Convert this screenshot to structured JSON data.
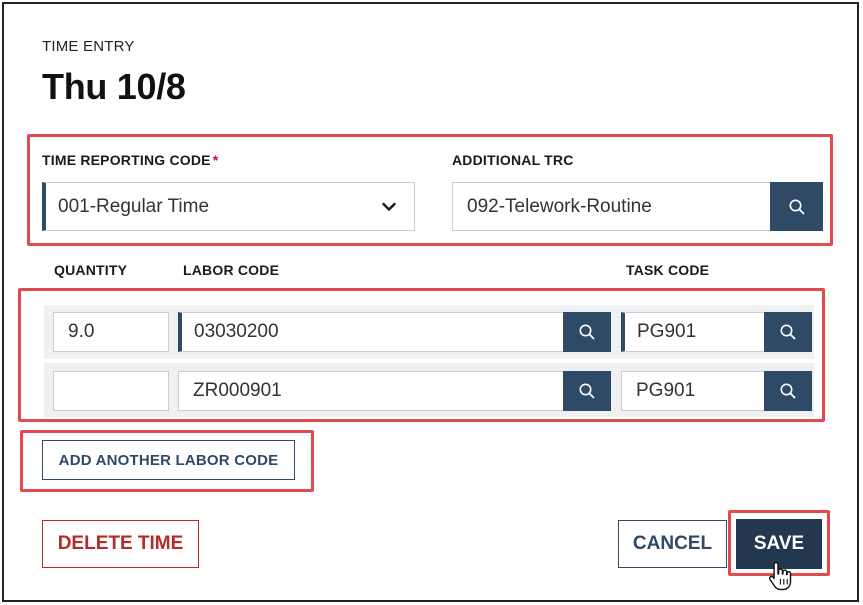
{
  "header": {
    "eyebrow": "TIME ENTRY",
    "title": "Thu 10/8"
  },
  "trc": {
    "label": "TIME REPORTING CODE",
    "required_mark": "*",
    "value": "001-Regular Time",
    "chevron_icon": "chevron-down-icon"
  },
  "additional_trc": {
    "label": "ADDITIONAL TRC",
    "value": "092-Telework-Routine",
    "search_icon": "search-icon"
  },
  "labor": {
    "headers": {
      "quantity": "QUANTITY",
      "labor_code": "LABOR CODE",
      "task_code": "TASK CODE"
    },
    "rows": [
      {
        "quantity": "9.0",
        "labor_code": "03030200",
        "task_code": "PG901"
      },
      {
        "quantity": "",
        "labor_code": "ZR000901",
        "task_code": "PG901"
      }
    ]
  },
  "buttons": {
    "add_labor": "ADD ANOTHER LABOR CODE",
    "delete": "DELETE TIME",
    "cancel": "CANCEL",
    "save": "SAVE"
  },
  "colors": {
    "accent": "#2f4a67",
    "highlight": "#e14b50",
    "delete": "#b52a2a",
    "save_bg": "#23384f"
  }
}
